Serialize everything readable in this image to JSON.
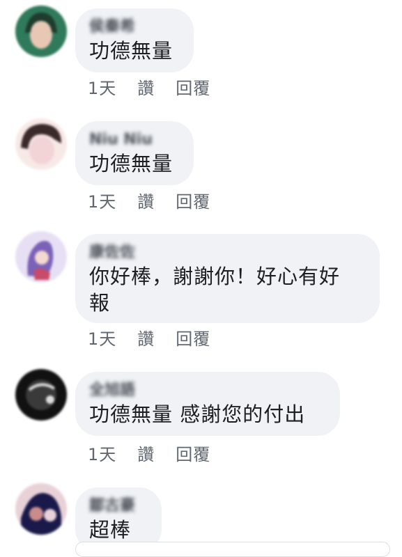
{
  "comments": [
    {
      "name": "侯秦希",
      "text": "功德無量",
      "time": "1天",
      "like": "讚",
      "reply": "回覆",
      "avatar_colors": [
        "#2f7a5b",
        "#e9c7b5",
        "#1f3c2e"
      ]
    },
    {
      "name": "Niu Niu",
      "text": "功德無量",
      "time": "1天",
      "like": "讚",
      "reply": "回覆",
      "avatar_colors": [
        "#f2d4d6",
        "#3b2a2a",
        "#f7e9e6"
      ]
    },
    {
      "name": "康佐佐",
      "text": "你好棒，謝謝你！好心有好\n報",
      "time": "1天",
      "like": "讚",
      "reply": "回覆",
      "avatar_colors": [
        "#7b62b8",
        "#e7e0f4",
        "#c94a6a"
      ]
    },
    {
      "name": "全旭語",
      "text": "功德無量 感謝您的付出",
      "time": "1天",
      "like": "讚",
      "reply": "回覆",
      "avatar_colors": [
        "#111111",
        "#3a3a3a",
        "#dddddd"
      ]
    },
    {
      "name": "鄒古豪",
      "text": "超棒",
      "time": "",
      "like": "",
      "reply": "",
      "avatar_colors": [
        "#1a1a4a",
        "#c98c8c",
        "#e8d2d8"
      ]
    }
  ]
}
